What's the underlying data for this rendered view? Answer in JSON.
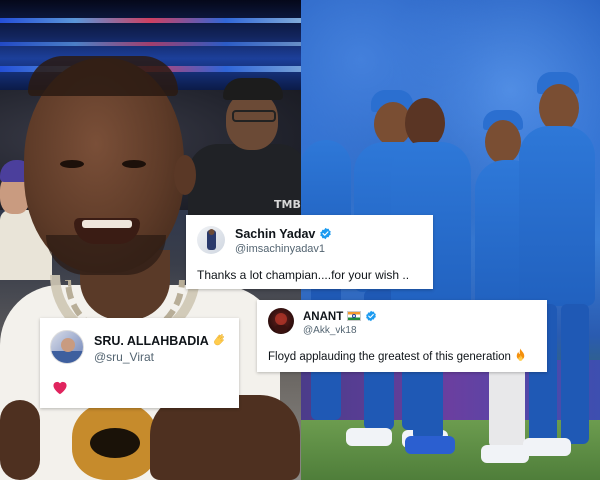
{
  "tweets": [
    {
      "name": "Sachin Yadav",
      "handle": "@imsachinyadav1",
      "text": "Thanks a lot champian....for your wish ..",
      "verified": true
    },
    {
      "name": "ANANT",
      "handle": "@Akk_vk18",
      "text": "Floyd applauding the greatest of this generation",
      "verified": true,
      "name_emoji": "india-flag",
      "text_emoji": "fire-emoji"
    },
    {
      "name": "SRU. ALLAHBADIA",
      "handle": "@sru_Virat",
      "name_emoji": "clapping-hands-emoji",
      "text_emoji": "red-heart-emoji"
    }
  ],
  "left_photo": {
    "shirt_badge": "TMB"
  },
  "colors": {
    "verified": "#1d9bf0",
    "heart": "#e0245e",
    "fire": "#f4900c",
    "clap": "#ffcc4d",
    "team_jersey": "#2e78d8"
  }
}
